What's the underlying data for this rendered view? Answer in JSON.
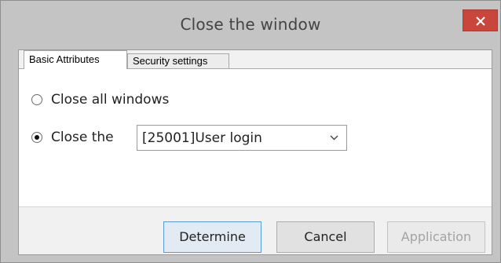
{
  "window": {
    "title": "Close the window",
    "close_glyph": "×"
  },
  "tabs": [
    {
      "label": "Basic Attributes",
      "active": true
    },
    {
      "label": "Security settings",
      "active": false
    }
  ],
  "options": {
    "close_all_label": "Close all windows",
    "close_the_label": "Close the",
    "selected_option": "close_the",
    "window_select": {
      "value": "[25001]User login"
    }
  },
  "buttons": {
    "determine": "Determine",
    "cancel": "Cancel",
    "application": "Application"
  },
  "colors": {
    "close_button": "#c9463d",
    "default_button_border": "#5b9bd5"
  },
  "icons": {
    "close": "close-icon",
    "dropdown": "chevron-down-icon"
  }
}
